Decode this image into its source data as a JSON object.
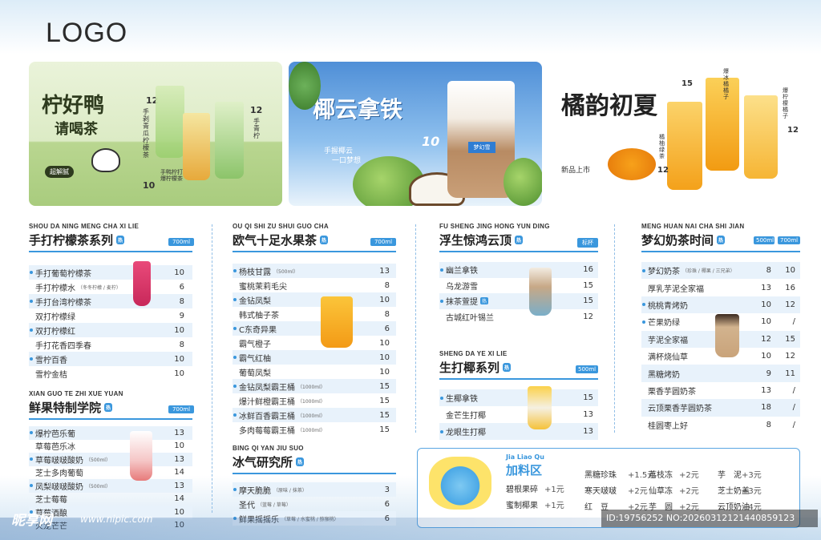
{
  "logo": "LOGO",
  "banners": {
    "b1": {
      "title1": "柠好鸭",
      "title2": "请喝茶",
      "badge": "超解腻",
      "label_a": "手剥青瓜柠檬茶",
      "price_a": "12",
      "label_b": "手青柠",
      "price_b": "12",
      "label_c": "手鸭柠打爆柠檬茶",
      "price_c": "10"
    },
    "b2": {
      "title": "椰云拿铁",
      "sub1": "手握椰云",
      "sub2": "一口梦想",
      "price": "10",
      "cup_brand": "梦幻雪"
    },
    "b3": {
      "title": "橘韵初夏",
      "tag": "新品上市",
      "label_a": "爆冰橘橘子",
      "price_a": "15",
      "label_b": "爆柠檬橘子",
      "price_b": "12",
      "label_c": "橘柚绿茶",
      "price_c": "12"
    }
  },
  "sections": {
    "s1": {
      "pinyin": "SHOU DA NING MENG CHA XI LIE",
      "title": "手打柠檬茶系列",
      "hot": "热",
      "size": "700ml",
      "items": [
        {
          "name": "手打葡萄柠檬茶",
          "note": "",
          "price": "10"
        },
        {
          "name": "手打柠檬水",
          "note": "（冬冬柠檬 / 麦柠）",
          "price": "6"
        },
        {
          "name": "手打台湾柠檬茶",
          "note": "",
          "price": "8"
        },
        {
          "name": "双打柠檬绿",
          "note": "",
          "price": "9"
        },
        {
          "name": "双打柠檬红",
          "note": "",
          "price": "10"
        },
        {
          "name": "手打花香四季春",
          "note": "",
          "price": "8"
        },
        {
          "name": "雪柠百香",
          "note": "",
          "price": "10"
        },
        {
          "name": "雪柠金桔",
          "note": "",
          "price": "10"
        }
      ]
    },
    "s2": {
      "pinyin": "XIAN GUO TE ZHI XUE YUAN",
      "title": "鲜果特制学院",
      "hot": "热",
      "size": "700ml",
      "items": [
        {
          "name": "爆柠芭乐葡",
          "note": "",
          "price": "13"
        },
        {
          "name": "草莓芭乐冰",
          "note": "",
          "price": "10"
        },
        {
          "name": "草莓啵啵酸奶",
          "note": "（500ml）",
          "price": "13"
        },
        {
          "name": "芝士多肉葡萄",
          "note": "",
          "price": "14"
        },
        {
          "name": "凤梨啵啵酸奶",
          "note": "（500ml）",
          "price": "13"
        },
        {
          "name": "芝士莓莓",
          "note": "",
          "price": "14"
        },
        {
          "name": "草莓酒酿",
          "note": "",
          "price": "10"
        },
        {
          "name": "火龙芒芒",
          "note": "",
          "price": "10"
        }
      ]
    },
    "s3": {
      "pinyin": "OU QI SHI ZU SHUI GUO CHA",
      "title": "欧气十足水果茶",
      "hot": "热",
      "size": "700ml",
      "items": [
        {
          "name": "杨枝甘露",
          "note": "（500ml）",
          "price": "13"
        },
        {
          "name": "蜜桃茉莉毛尖",
          "note": "",
          "price": "8"
        },
        {
          "name": "金钻凤梨",
          "note": "",
          "price": "10"
        },
        {
          "name": "韩式柚子茶",
          "note": "",
          "price": "8"
        },
        {
          "name": "C东奇异果",
          "note": "",
          "price": "6"
        },
        {
          "name": "霸气橙子",
          "note": "",
          "price": "10"
        },
        {
          "name": "霸气红柚",
          "note": "",
          "price": "10"
        },
        {
          "name": "葡萄凤梨",
          "note": "",
          "price": "10"
        },
        {
          "name": "金钻凤梨霸王桶",
          "note": "（1000ml）",
          "price": "15"
        },
        {
          "name": "爆汁鲜橙霸王桶",
          "note": "（1000ml）",
          "price": "15"
        },
        {
          "name": "冰鲜百香霸王桶",
          "note": "（1000ml）",
          "price": "15"
        },
        {
          "name": "多肉莓莓霸王桶",
          "note": "（1000ml）",
          "price": "15"
        }
      ]
    },
    "s4": {
      "pinyin": "BING QI YAN JIU SUO",
      "title": "冰气研究所",
      "hot": "热",
      "items": [
        {
          "name": "摩天脆脆",
          "note": "（原味 / 抹茶）",
          "price": "3"
        },
        {
          "name": "圣代",
          "note": "（蓝莓 / 草莓）",
          "price": "6"
        },
        {
          "name": "鲜果摇摇乐",
          "note": "（草莓 / 水蜜桃 / 猕猴桃）",
          "price": "6"
        }
      ]
    },
    "s5": {
      "pinyin": "FU SHENG JING HONG YUN DING",
      "title": "浮生惊鸿云顶",
      "hot": "热",
      "size": "标杯",
      "items": [
        {
          "name": "幽兰拿铁",
          "note": "",
          "price": "16",
          "tag": ""
        },
        {
          "name": "乌龙游雪",
          "note": "",
          "price": "15",
          "tag": ""
        },
        {
          "name": "抹茶萱提",
          "note": "",
          "price": "15",
          "tag": "热"
        },
        {
          "name": "古城红叶锡兰",
          "note": "",
          "price": "12",
          "tag": ""
        }
      ]
    },
    "s6": {
      "pinyin": "SHENG DA YE XI LIE",
      "title": "生打椰系列",
      "hot": "热",
      "size": "500ml",
      "items": [
        {
          "name": "生椰拿铁",
          "note": "",
          "price": "15"
        },
        {
          "name": "金芒生打椰",
          "note": "",
          "price": "13"
        },
        {
          "name": "龙眼生打椰",
          "note": "",
          "price": "13"
        }
      ]
    },
    "s7": {
      "pinyin": "MENG HUAN NAI CHA SHI JIAN",
      "title": "梦幻奶茶时间",
      "hot": "热",
      "size_a": "500ml",
      "size_b": "700ml",
      "items": [
        {
          "name": "梦幻奶茶",
          "note": "（珍珠 / 椰果 / 三兄弟）",
          "price_a": "8",
          "price_b": "10",
          "dot": true
        },
        {
          "name": "厚乳芋泥全家福",
          "note": "",
          "price_a": "13",
          "price_b": "16",
          "dot": false
        },
        {
          "name": "桃桃青烤奶",
          "note": "",
          "price_a": "10",
          "price_b": "12",
          "dot": true
        },
        {
          "name": "芒果奶绿",
          "note": "",
          "price_a": "10",
          "price_b": "/",
          "dot": true
        },
        {
          "name": "芋泥全家福",
          "note": "",
          "price_a": "12",
          "price_b": "15",
          "dot": false
        },
        {
          "name": "满杯烧仙草",
          "note": "",
          "price_a": "10",
          "price_b": "12",
          "dot": false
        },
        {
          "name": "黑糖烤奶",
          "note": "",
          "price_a": "9",
          "price_b": "11",
          "dot": false
        },
        {
          "name": "栗香芋圆奶茶",
          "note": "",
          "price_a": "13",
          "price_b": "/",
          "dot": false
        },
        {
          "name": "云顶栗香芋圆奶茶",
          "note": "",
          "price_a": "18",
          "price_b": "/",
          "dot": false
        },
        {
          "name": "桂圆枣上好",
          "note": "",
          "price_a": "8",
          "price_b": "/",
          "dot": false
        }
      ]
    }
  },
  "extras": {
    "pinyin": "Jia Liao Qu",
    "title": "加料区",
    "col1": [
      {
        "name": "碧根果碎",
        "price": "+1元"
      },
      {
        "name": "蜜制椰果",
        "price": "+1元"
      }
    ],
    "col2": [
      {
        "name": "黑糖珍珠",
        "price": "+1.5元"
      },
      {
        "name": "寒天啵啵",
        "price": "+2元"
      },
      {
        "name": "红　豆",
        "price": "+2元"
      }
    ],
    "col3": [
      {
        "name": "荔枝冻",
        "price": "+2元"
      },
      {
        "name": "仙草冻",
        "price": "+2元"
      },
      {
        "name": "芋　圆",
        "price": "+2元"
      }
    ],
    "col4": [
      {
        "name": "芋　泥",
        "price": "+3元"
      },
      {
        "name": "芝士奶盖",
        "price": "+3元"
      },
      {
        "name": "云顶奶油",
        "price": "+4元"
      }
    ]
  },
  "watermark": {
    "site_cn": "昵享网",
    "site_url": "www.nipic.com",
    "id_text": "ID:19756252 NO:20260312121440859123"
  }
}
